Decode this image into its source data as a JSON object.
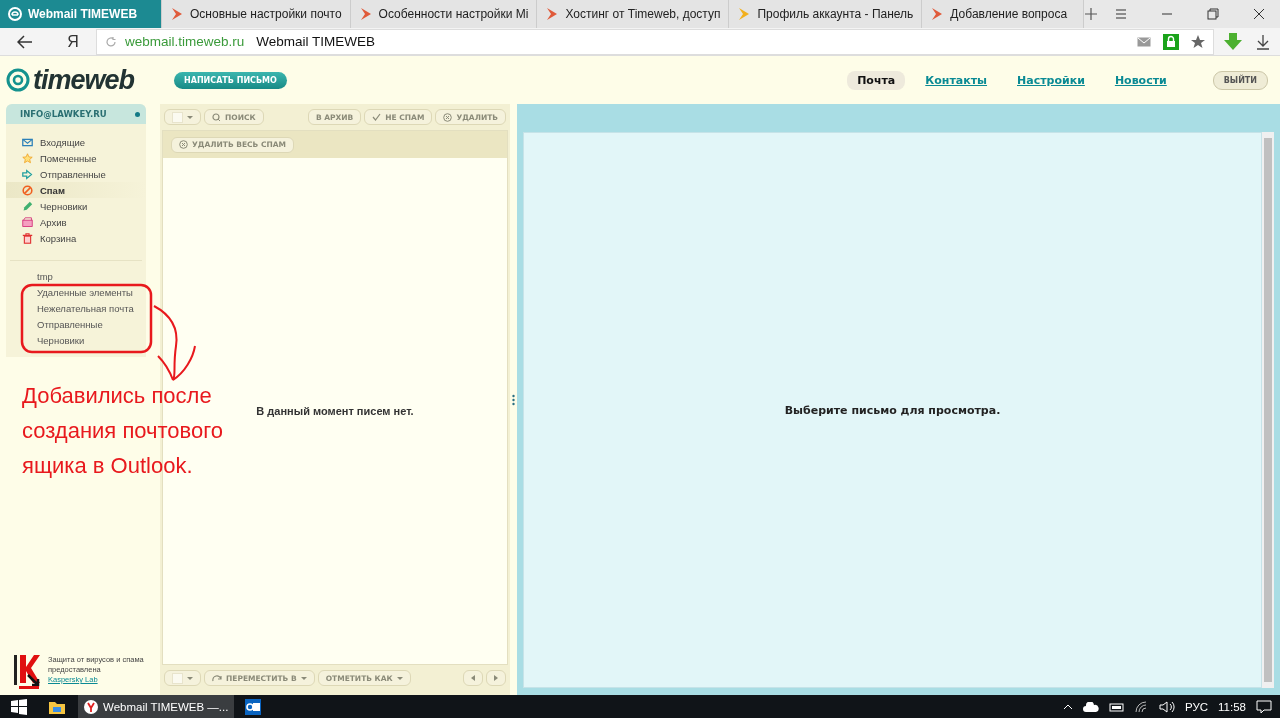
{
  "browser": {
    "tabs": [
      {
        "title": "Webmail TIMEWEB",
        "selected": true,
        "color": "#ffffff"
      },
      {
        "title": "Основные настройки почто",
        "selected": false,
        "color": "#e05a3a"
      },
      {
        "title": "Особенности настройки Mi",
        "selected": false,
        "color": "#e05a3a"
      },
      {
        "title": "Хостинг от Timeweb, доступ",
        "selected": false,
        "color": "#e05a3a"
      },
      {
        "title": "Профиль аккаунта - Панель",
        "selected": false,
        "color": "#f2b01e"
      },
      {
        "title": "Добавление вопроса",
        "selected": false,
        "color": "#e05a3a"
      }
    ],
    "yandex_button": "Я",
    "url": "webmail.timeweb.ru",
    "page_title": "Webmail TIMEWEB"
  },
  "header": {
    "logo": "timeweb",
    "compose": "НАПИСАТЬ ПИСЬМО",
    "nav": [
      {
        "label": "Почта",
        "selected": true
      },
      {
        "label": "Контакты",
        "selected": false
      },
      {
        "label": "Настройки",
        "selected": false
      },
      {
        "label": "Новости",
        "selected": false
      }
    ],
    "logout": "ВЫЙТИ"
  },
  "sidebar": {
    "account": "INFO@LAWKEY.RU",
    "folders": [
      {
        "label": "Входящие",
        "kind": "inbox",
        "selected": false
      },
      {
        "label": "Помеченные",
        "kind": "starred",
        "selected": false
      },
      {
        "label": "Отправленные",
        "kind": "sent",
        "selected": false
      },
      {
        "label": "Спам",
        "kind": "spam",
        "selected": true
      },
      {
        "label": "Черновики",
        "kind": "drafts",
        "selected": false
      },
      {
        "label": "Архив",
        "kind": "archive",
        "selected": false
      },
      {
        "label": "Корзина",
        "kind": "trash",
        "selected": false
      }
    ],
    "custom_folders": [
      "tmp",
      "Удаленные элементы",
      "Нежелательная почта",
      "Отправленные",
      "Черновики"
    ],
    "antivirus_text": "Защита от вирусов и спама предоставлена",
    "antivirus_link": "Kaspersky Lab"
  },
  "list": {
    "search": "ПОИСК",
    "actions": [
      "В АРХИВ",
      "НЕ СПАМ",
      "УДАЛИТЬ"
    ],
    "delete_all_spam": "УДАЛИТЬ ВЕСЬ СПАМ",
    "empty": "В данный момент писем нет.",
    "move_to": "ПЕРЕМЕСТИТЬ В",
    "mark_as": "ОТМЕТИТЬ КАК"
  },
  "preview": {
    "empty": "Выберите письмо для просмотра."
  },
  "annotation": "Добавились после создания почтового ящика в Outlook.",
  "taskbar": {
    "app": "Webmail TIMEWEB —...",
    "language": "РУС",
    "time": "11:58"
  }
}
